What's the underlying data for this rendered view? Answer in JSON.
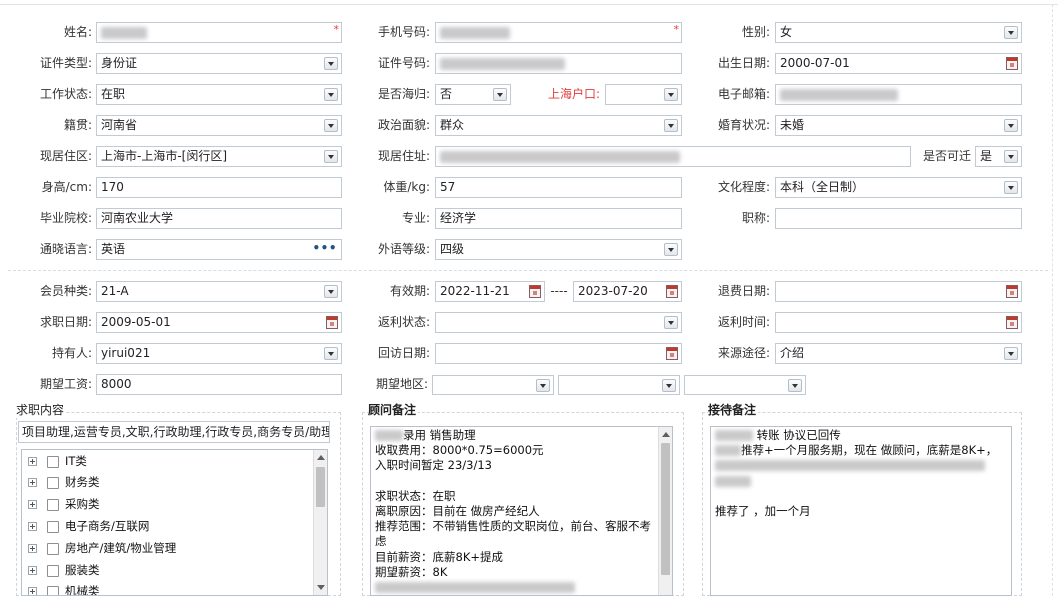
{
  "personal": {
    "name_label": "姓名:",
    "phone_label": "手机号码:",
    "gender_label": "性别:",
    "gender_value": "女",
    "id_type_label": "证件类型:",
    "id_type_value": "身份证",
    "id_no_label": "证件号码:",
    "birth_label": "出生日期:",
    "birth_value": "2000-07-01",
    "work_status_label": "工作状态:",
    "work_status_value": "在职",
    "overseas_label": "是否海归:",
    "overseas_value": "否",
    "shanghai_hukou_label": "上海户口:",
    "email_label": "电子邮箱:",
    "native_label": "籍贯:",
    "native_value": "河南省",
    "political_label": "政治面貌:",
    "political_value": "群众",
    "marital_label": "婚育状况:",
    "marital_value": "未婚",
    "residence_area_label": "现居住区:",
    "residence_area_value": "上海市-上海市-[闵行区]",
    "address_label": "现居住址:",
    "relocate_label": "是否可迁",
    "relocate_value": "是",
    "height_label": "身高/cm:",
    "height_value": "170",
    "weight_label": "体重/kg:",
    "weight_value": "57",
    "education_label": "文化程度:",
    "education_value": "本科（全日制）",
    "school_label": "毕业院校:",
    "school_value": "河南农业大学",
    "major_label": "专业:",
    "major_value": "经济学",
    "title_label": "职称:",
    "language_label": "通晓语言:",
    "language_value": "英语",
    "language_more": "•••",
    "foreign_level_label": "外语等级:",
    "foreign_level_value": "四级"
  },
  "membership": {
    "member_type_label": "会员种类:",
    "member_type_value": "21-A",
    "valid_label": "有效期:",
    "valid_from": "2022-11-21",
    "valid_sep": "----",
    "valid_to": "2023-07-20",
    "refund_date_label": "退费日期:",
    "job_date_label": "求职日期:",
    "job_date_value": "2009-05-01",
    "rebate_status_label": "返利状态:",
    "rebate_time_label": "返利时间:",
    "holder_label": "持有人:",
    "holder_value": "yirui021",
    "visit_date_label": "回访日期:",
    "source_label": "来源途径:",
    "source_value": "介绍",
    "salary_label": "期望工资:",
    "salary_value": "8000",
    "region_label": "期望地区:"
  },
  "job_content": {
    "title": "求职内容",
    "summary": "项目助理,运营专员,文职,行政助理,行政专员,商务专员/助理",
    "categories": [
      "IT类",
      "财务类",
      "采购类",
      "电子商务/互联网",
      "房地产/建筑/物业管理",
      "服装类",
      "机械类"
    ]
  },
  "consultant_notes": {
    "title": "顾问备注",
    "lines": [
      "录用 销售助理",
      "收取费用：8000*0.75=6000元",
      "入职时间暂定 23/3/13",
      "",
      "求职状态：在职",
      "离职原因：目前在 做房产经纪人",
      "推荐范围：不带销售性质的文职岗位，前台、客服不考虑",
      "目前薪资：底薪8K+提成",
      "期望薪资：8K"
    ]
  },
  "reception_notes": {
    "title": "接待备注",
    "lines": [
      "转账 协议已回传",
      "推荐+一个月服务期，现在 做顾问，底薪是8K+，",
      "",
      "推荐了 ，加一个月"
    ]
  }
}
